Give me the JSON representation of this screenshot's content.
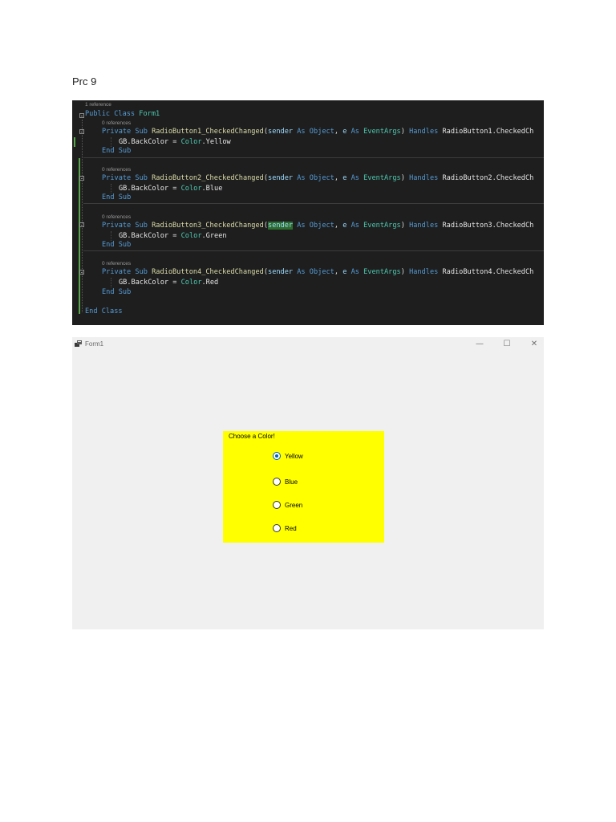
{
  "document": {
    "heading": "Prc 9"
  },
  "code": {
    "top_lens": "1 reference",
    "class_decl": [
      "Public",
      "Class",
      "Form1"
    ],
    "end_class": "End Class",
    "subs": [
      {
        "lens": "0 references",
        "private": "Private",
        "sub": "Sub",
        "name": "RadioButton1_CheckedChanged",
        "sig_sender": "sender",
        "sig_as1": "As",
        "sig_object": "Object",
        "sig_comma": ", ",
        "sig_e": "e",
        "sig_as2": "As",
        "sig_eventargs": "EventArgs",
        "handles": "Handles",
        "handler": "RadioButton1",
        "handler_event": ".CheckedCh",
        "body_obj": "GB.BackColor",
        "body_eq": " = ",
        "body_type": "Color",
        "body_value": ".Yellow",
        "end": [
          "End",
          "Sub"
        ]
      },
      {
        "lens": "0 references",
        "private": "Private",
        "sub": "Sub",
        "name": "RadioButton2_CheckedChanged",
        "sig_sender": "sender",
        "sig_as1": "As",
        "sig_object": "Object",
        "sig_comma": ", ",
        "sig_e": "e",
        "sig_as2": "As",
        "sig_eventargs": "EventArgs",
        "handles": "Handles",
        "handler": "RadioButton2",
        "handler_event": ".CheckedCh",
        "body_obj": "GB.BackColor",
        "body_eq": " = ",
        "body_type": "Color",
        "body_value": ".Blue",
        "end": [
          "End",
          "Sub"
        ]
      },
      {
        "lens": "0 references",
        "private": "Private",
        "sub": "Sub",
        "name": "RadioButton3_CheckedChanged",
        "sig_sender": "sender",
        "sig_as1": "As",
        "sig_object": "Object",
        "sig_comma": ", ",
        "sig_e": "e",
        "sig_as2": "As",
        "sig_eventargs": "EventArgs",
        "handles": "Handles",
        "handler": "RadioButton3",
        "handler_event": ".CheckedCh",
        "body_obj": "GB.BackColor",
        "body_eq": " = ",
        "body_type": "Color",
        "body_value": ".Green",
        "end": [
          "End",
          "Sub"
        ]
      },
      {
        "lens": "0 references",
        "private": "Private",
        "sub": "Sub",
        "name": "RadioButton4_CheckedChanged",
        "sig_sender": "sender",
        "sig_as1": "As",
        "sig_object": "Object",
        "sig_comma": ", ",
        "sig_e": "e",
        "sig_as2": "As",
        "sig_eventargs": "EventArgs",
        "handles": "Handles",
        "handler": "RadioButton4",
        "handler_event": ".CheckedCh",
        "body_obj": "GB.BackColor",
        "body_eq": " = ",
        "body_type": "Color",
        "body_value": ".Red",
        "end": [
          "End",
          "Sub"
        ]
      }
    ]
  },
  "form": {
    "title": "Form1",
    "icon": "form-app-icon",
    "controls": {
      "minimize": "—",
      "maximize": "☐",
      "close": "✕"
    },
    "groupbox": {
      "title": "Choose a Color!",
      "back_color": "#ffff00",
      "options": [
        {
          "label": "Yellow",
          "checked": true
        },
        {
          "label": "Blue",
          "checked": false
        },
        {
          "label": "Green",
          "checked": false
        },
        {
          "label": "Red",
          "checked": false
        }
      ]
    }
  }
}
